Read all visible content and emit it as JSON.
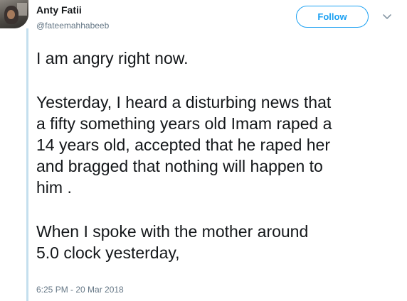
{
  "author": {
    "name": "Anty Fatii",
    "handle": "@fateemahhabeeb",
    "avatar_icon": "profile-photo"
  },
  "actions": {
    "follow_label": "Follow",
    "more_icon": "chevron-down-icon"
  },
  "tweet": {
    "lines_p1": [
      "I am angry right now."
    ],
    "lines_p2": [
      "Yesterday, I heard a disturbing news that",
      "a fifty something years old Imam raped a",
      "14 years old, accepted that he raped her",
      "and bragged that nothing will happen to",
      "him ."
    ],
    "lines_p3": [
      "When I spoke with the mother around",
      "5.0 clock yesterday,"
    ],
    "timestamp": "6:25 PM - 20 Mar 2018"
  },
  "colors": {
    "accent": "#1da1f2",
    "text": "#14171a",
    "secondary": "#657786",
    "thread_line": "#c4dfee"
  }
}
